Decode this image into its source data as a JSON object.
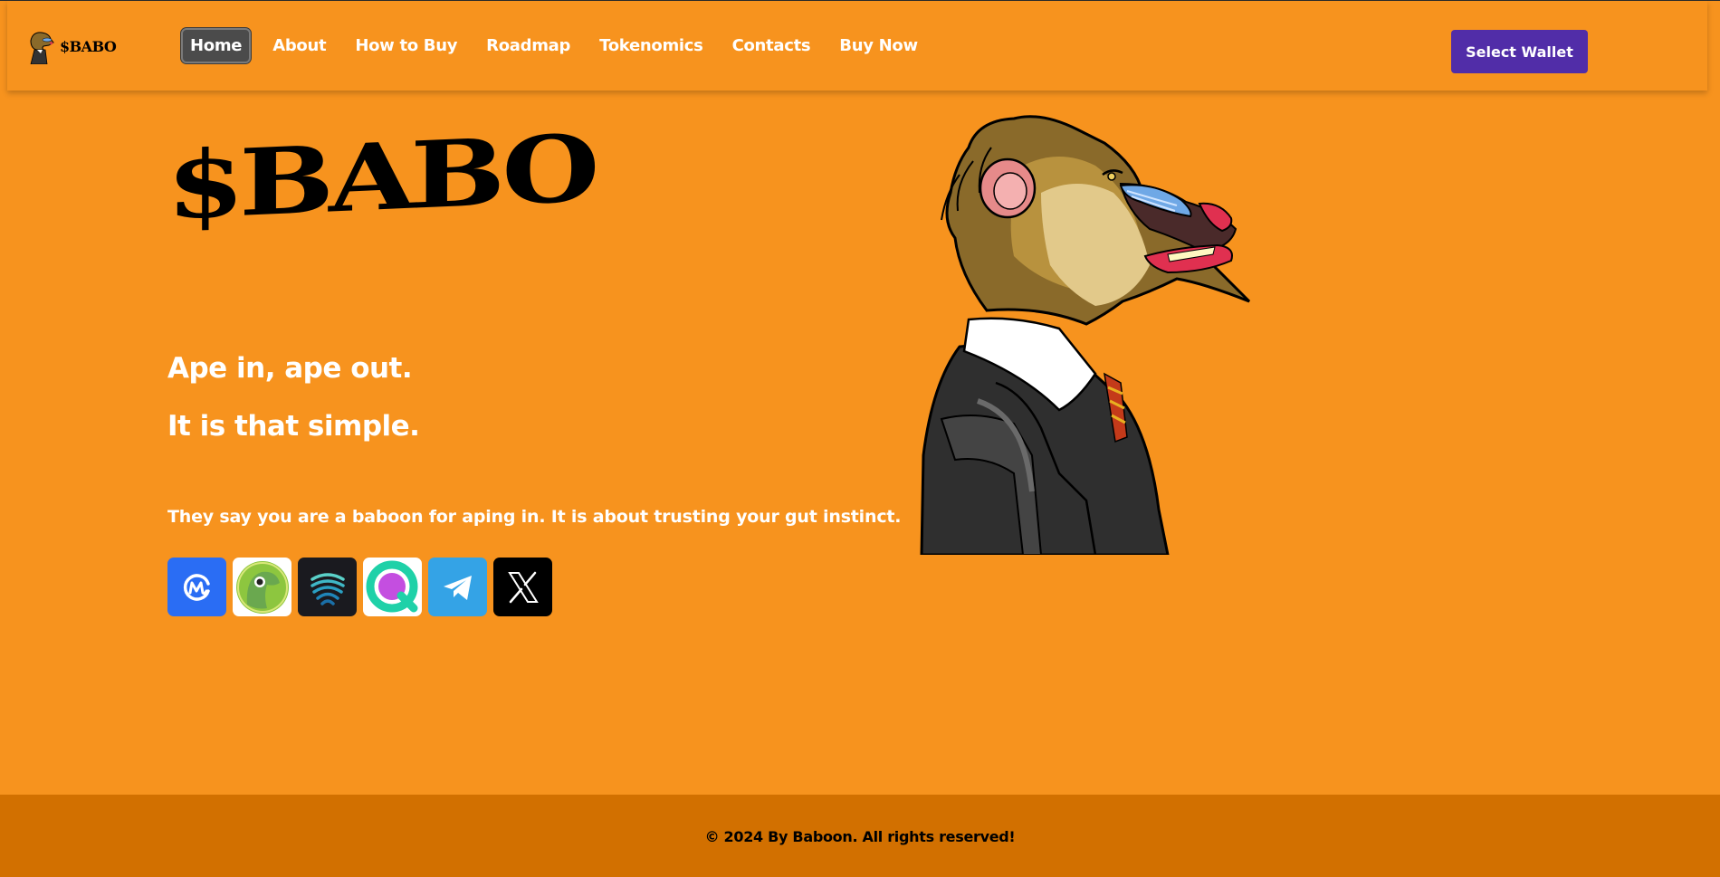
{
  "brand": {
    "name": "$BABO",
    "logo_icon": "baboon-logo-icon"
  },
  "nav": {
    "items": [
      {
        "label": "Home",
        "active": true
      },
      {
        "label": "About"
      },
      {
        "label": "How to Buy"
      },
      {
        "label": "Roadmap"
      },
      {
        "label": "Tokenomics"
      },
      {
        "label": "Contacts"
      },
      {
        "label": "Buy Now"
      }
    ],
    "wallet_button": "Select Wallet"
  },
  "hero": {
    "title": "$BABO",
    "tagline_1": "Ape in, ape out.",
    "tagline_2": "It is that simple.",
    "description": "They say you are a baboon for aping in. It is about trusting your gut instinct.",
    "image_icon": "baboon-in-suit-illustration"
  },
  "socials": [
    {
      "name": "CoinMarketCap",
      "icon": "coinmarketcap-icon"
    },
    {
      "name": "CoinGecko",
      "icon": "coingecko-icon"
    },
    {
      "name": "DexScreener",
      "icon": "dexscreener-icon"
    },
    {
      "name": "Quickswap",
      "icon": "quickswap-icon"
    },
    {
      "name": "Telegram",
      "icon": "telegram-icon"
    },
    {
      "name": "X",
      "icon": "x-icon"
    }
  ],
  "footer": {
    "copyright": "© 2024 By Baboon. All rights reserved!"
  },
  "colors": {
    "background": "#f7931e",
    "footer": "#d27000",
    "wallet_button": "#512da8",
    "active_nav": "#4b4b4b"
  }
}
